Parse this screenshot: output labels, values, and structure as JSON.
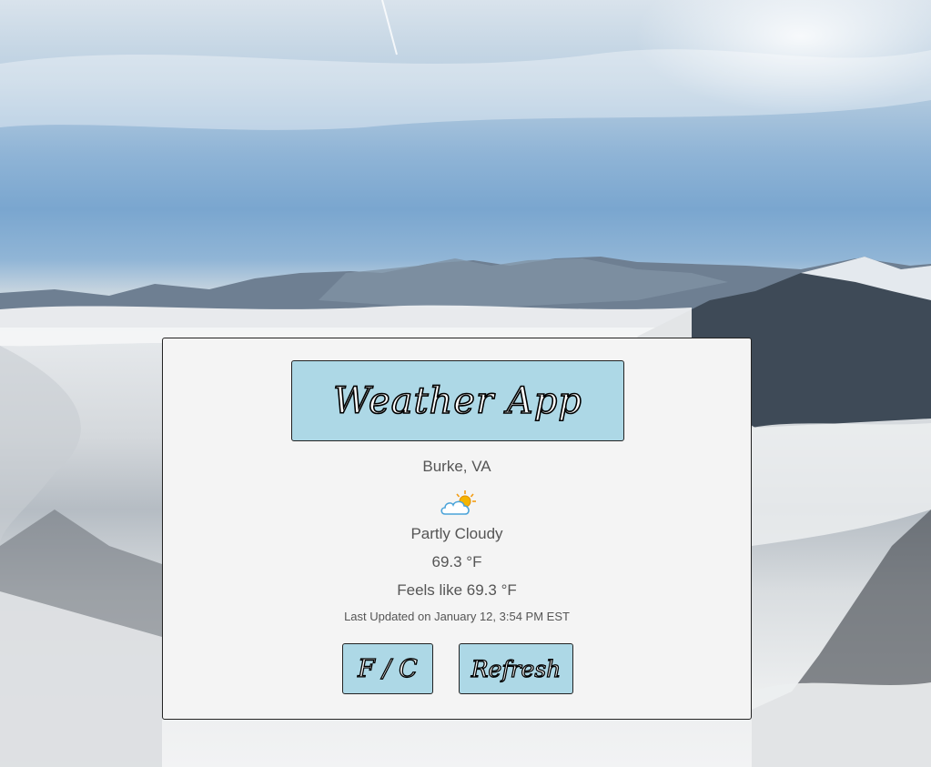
{
  "app": {
    "title": "Weather App"
  },
  "weather": {
    "location": "Burke, VA",
    "icon": "partly-cloudy-icon",
    "condition": "Partly Cloudy",
    "temperature": "69.3 °F",
    "feels_like": "Feels like 69.3 °F",
    "last_updated": "Last Updated on January 12, 3:54 PM EST"
  },
  "buttons": {
    "unit_toggle_label": "F / C",
    "refresh_label": "Refresh"
  },
  "colors": {
    "accent": "#add8e6",
    "card_background": "#f4f4f4",
    "text": "#555555"
  }
}
